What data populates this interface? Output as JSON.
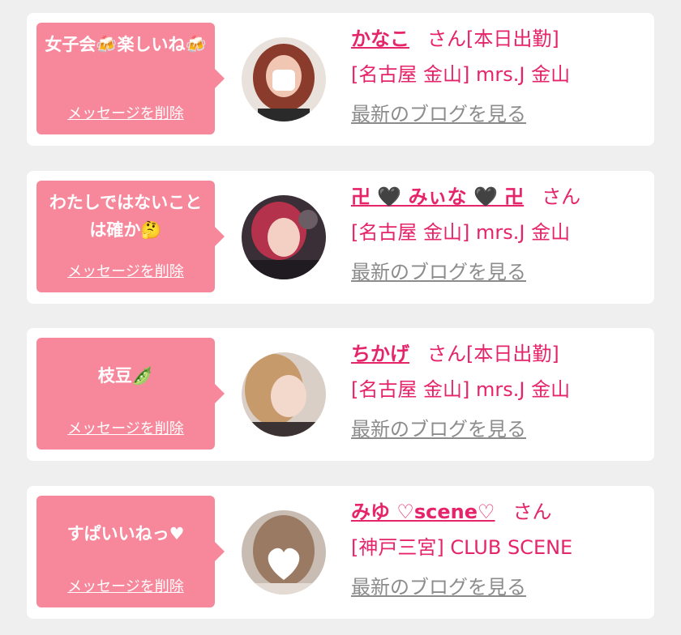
{
  "entries": [
    {
      "message": "女子会🍻楽しいね🍻",
      "delete_label": "メッセージを削除",
      "name": "かなこ",
      "honorific": "さん",
      "status": "[本日出勤]",
      "shop": "[名古屋 金山] mrs.J 金山",
      "blog_label": "最新のブログを見る"
    },
    {
      "message": "わたしではないことは確か🤔",
      "delete_label": "メッセージを削除",
      "name": "卍 🖤 みぃな 🖤 卍",
      "honorific": "さん",
      "status": "",
      "shop": "[名古屋 金山] mrs.J 金山",
      "blog_label": "最新のブログを見る"
    },
    {
      "message": "枝豆🫛",
      "delete_label": "メッセージを削除",
      "name": "ちかげ",
      "honorific": "さん",
      "status": "[本日出勤]",
      "shop": "[名古屋 金山] mrs.J 金山",
      "blog_label": "最新のブログを見る"
    },
    {
      "message": "すぱいいねっ♥",
      "delete_label": "メッセージを削除",
      "name": "みゆ ♡scene♡",
      "honorific": "さん",
      "status": "",
      "shop": "[神戸三宮] CLUB SCENE",
      "blog_label": "最新のブログを見る"
    }
  ],
  "colors": {
    "background": "#efefef",
    "card": "#ffffff",
    "bubble": "#f7889b",
    "accent": "#e6246a",
    "muted_link": "#8c8c8c"
  }
}
